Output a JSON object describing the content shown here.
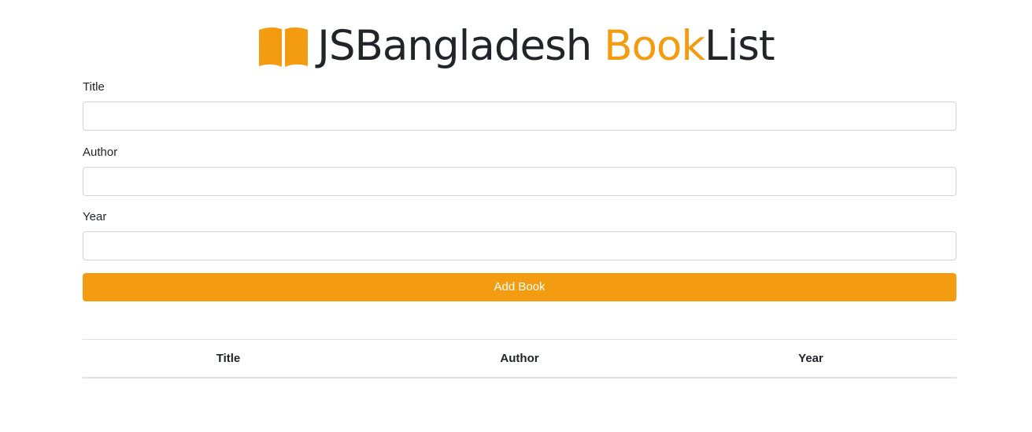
{
  "header": {
    "title_part1": "JSBangladesh ",
    "title_accent": "Book",
    "title_part2": "List",
    "icon": "book-open-icon",
    "accent_color": "#f39c12"
  },
  "form": {
    "title_label": "Title",
    "title_value": "",
    "author_label": "Author",
    "author_value": "",
    "year_label": "Year",
    "year_value": "",
    "submit_label": "Add Book"
  },
  "table": {
    "columns": [
      "Title",
      "Author",
      "Year"
    ],
    "rows": []
  }
}
